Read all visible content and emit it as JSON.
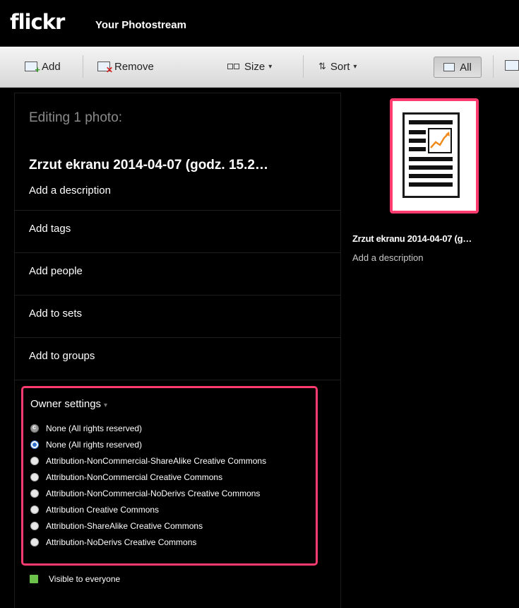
{
  "app": {
    "logo": "flickr",
    "page_title": "Your Photostream"
  },
  "toolbar": {
    "add_label": "Add",
    "remove_label": "Remove",
    "size_label": "Size",
    "sort_label": "Sort",
    "all_label": "All"
  },
  "editor": {
    "heading": "Editing 1 photo:",
    "photo_title": "Zrzut ekranu 2014-04-07 (godz. 15.2…",
    "description_placeholder": "Add a description",
    "rows": [
      "Add tags",
      "Add people",
      "Add to sets",
      "Add to groups"
    ],
    "owner_settings": {
      "title": "Owner settings",
      "options": [
        {
          "label": "None (All rights reserved)",
          "state": "copyright"
        },
        {
          "label": "None (All rights reserved)",
          "state": "selected"
        },
        {
          "label": "Attribution-NonCommercial-ShareAlike Creative Commons",
          "state": "unselected"
        },
        {
          "label": "Attribution-NonCommercial Creative Commons",
          "state": "unselected"
        },
        {
          "label": "Attribution-NonCommercial-NoDerivs Creative Commons",
          "state": "unselected"
        },
        {
          "label": "Attribution Creative Commons",
          "state": "unselected"
        },
        {
          "label": "Attribution-ShareAlike Creative Commons",
          "state": "unselected"
        },
        {
          "label": "Attribution-NoDerivs Creative Commons",
          "state": "unselected"
        }
      ]
    },
    "visibility": "Visible to everyone"
  },
  "thumbnail": {
    "name": "Zrzut ekranu 2014-04-07 (g…",
    "description": "Add a description",
    "icon": "document-chart-icon"
  },
  "colors": {
    "highlight": "#ff3b6f",
    "visible_green": "#6cc24a",
    "radio_blue": "#2f6fd0"
  }
}
